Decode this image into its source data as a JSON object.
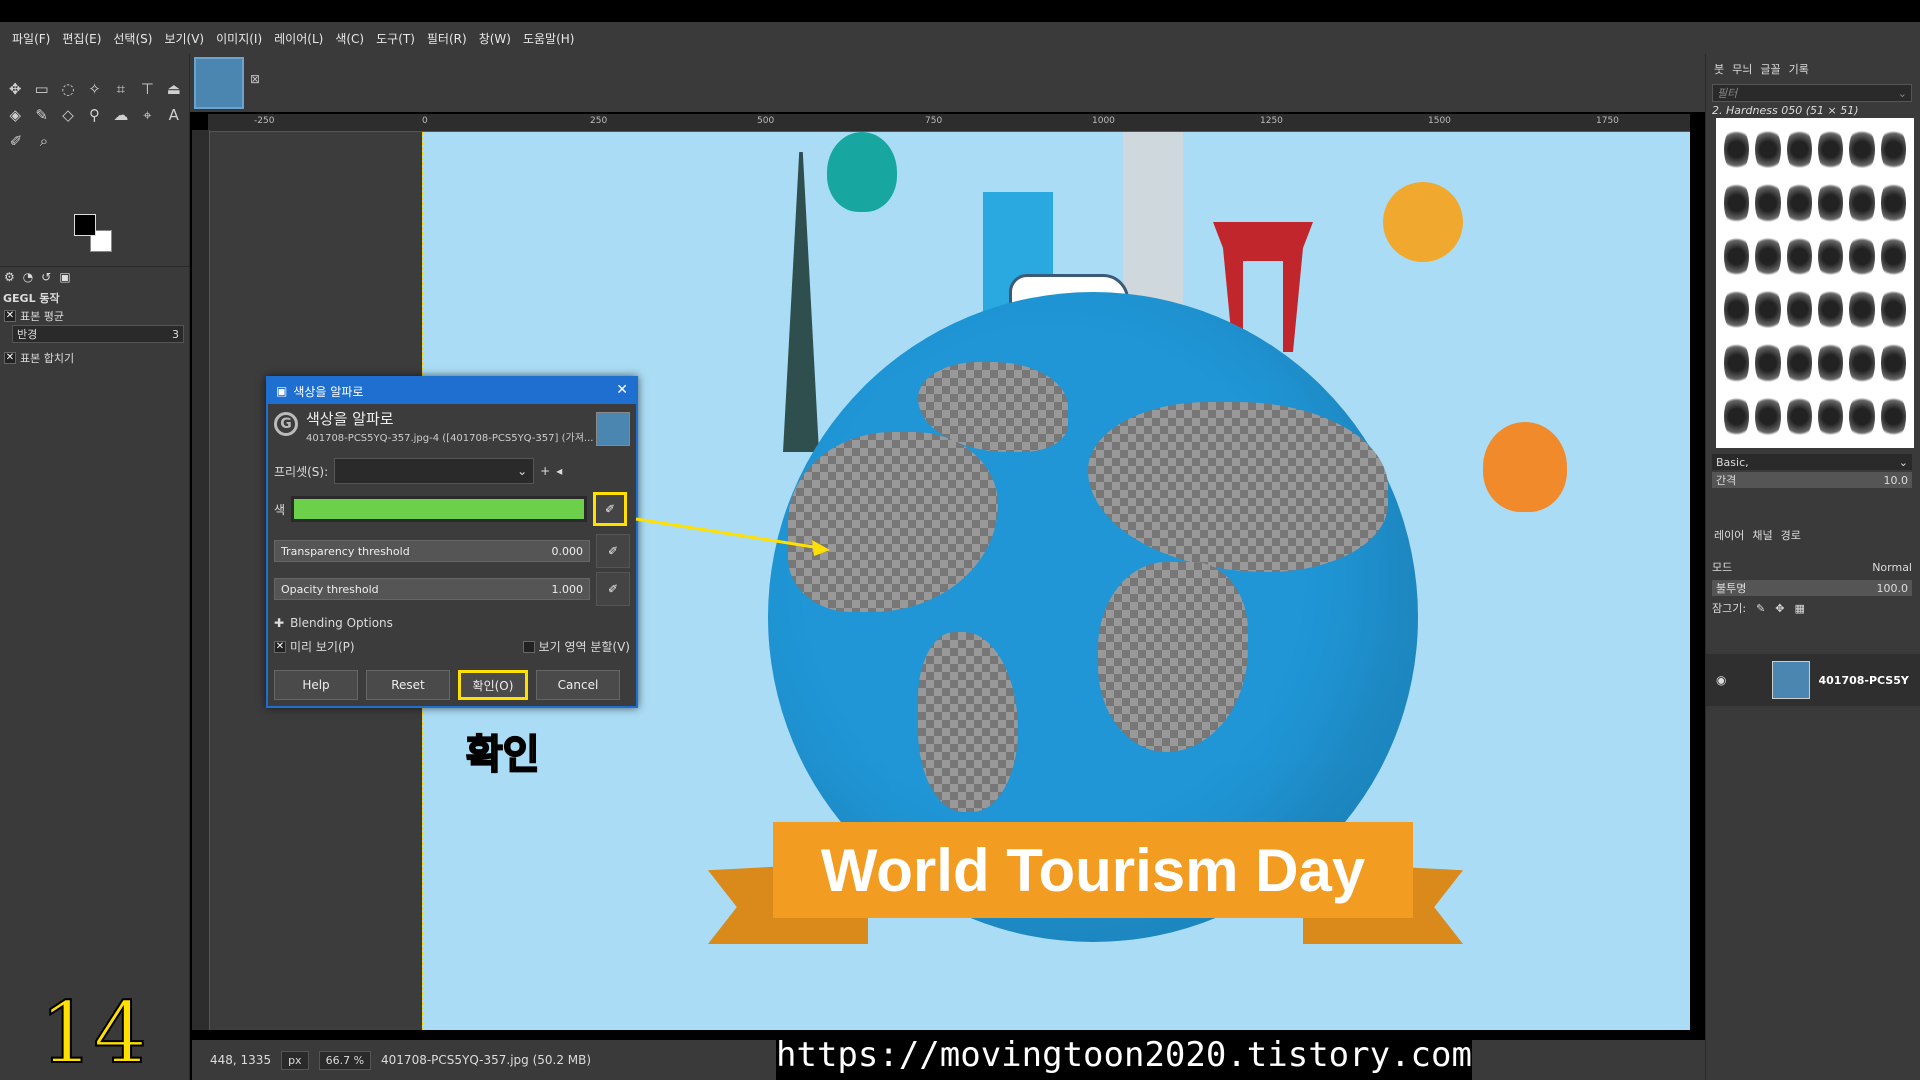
{
  "menu": [
    "파일(F)",
    "편집(E)",
    "선택(S)",
    "보기(V)",
    "이미지(I)",
    "레이어(L)",
    "색(C)",
    "도구(T)",
    "필터(R)",
    "창(W)",
    "도움말(H)"
  ],
  "toolbox": {
    "gegl_title": "GEGL 동작",
    "sample_average": "표본 평균",
    "radius_label": "반경",
    "radius_value": "3",
    "sample_merged": "표본 합치기"
  },
  "ruler": {
    "ticks": [
      "-250",
      "0",
      "250",
      "500",
      "750",
      "1000",
      "1250",
      "1500",
      "1750"
    ]
  },
  "image": {
    "banner_text": "World Tourism Day"
  },
  "dialog": {
    "window_title": "색상을 알파로",
    "heading": "색상을 알파로",
    "subtitle": "401708-PCS5YQ-357.jpg-4 ([401708-PCS5YQ-357] (가져...",
    "preset_label": "프리셋(S):",
    "color_label": "색",
    "color_value": "#6cd04a",
    "transparency_label": "Transparency threshold",
    "transparency_value": "0.000",
    "opacity_label": "Opacity threshold",
    "opacity_value": "1.000",
    "blending_label": "Blending Options",
    "preview_label": "미리 보기(P)",
    "split_label": "보기 영역 분할(V)",
    "btn_help": "Help",
    "btn_reset": "Reset",
    "btn_ok": "확인(O)",
    "btn_cancel": "Cancel"
  },
  "right_panel": {
    "tabs": [
      "붓",
      "무늬",
      "글꼴",
      "기록"
    ],
    "filter_placeholder": "필터",
    "brush_name": "2. Hardness 050 (51 × 51)",
    "brush_preset": "Basic,",
    "spacing_label": "간격",
    "spacing_value": "10.0",
    "layer_tabs": [
      "레이어",
      "채널",
      "경로"
    ],
    "mode_label": "모드",
    "mode_value": "Normal",
    "opacity_label": "불투명",
    "opacity_value": "100.0",
    "lock_label": "잠그기:",
    "layer_name": "401708-PCS5Y"
  },
  "status": {
    "coords": "448, 1335",
    "unit": "px",
    "zoom": "66.7 %",
    "file_info": "401708-PCS5YQ-357.jpg (50.2 MB)"
  },
  "overlay": {
    "annotation": "확인",
    "step_number": "14",
    "url": "https://movingtoon2020.tistory.com",
    "highlight_color": "#ffe000"
  }
}
